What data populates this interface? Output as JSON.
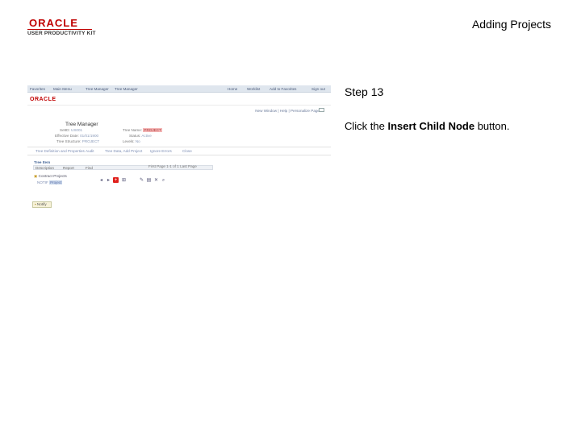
{
  "header": {
    "brand": "ORACLE",
    "product": "USER PRODUCTIVITY KIT",
    "doc_title": "Adding Projects"
  },
  "screenshot": {
    "brand": "ORACLE",
    "top_nav": [
      "Favorites",
      "Main Menu",
      "Tree Manager",
      "Tree Manager"
    ],
    "top_right_nav": [
      "Home",
      "Worklist",
      "Add to Favorites",
      "Sign out"
    ],
    "tool_links": "New Window | Help | Personalize Page",
    "page_title": "Tree Manager",
    "fields": {
      "setid_label": "SetID:",
      "setid_value": "US001",
      "tree_name_label": "Tree Name:",
      "tree_name_value": "PROJECT",
      "effective_date_label": "Effective Date:",
      "effective_date_value": "01/01/1900",
      "status_label": "Status:",
      "status_value": "Active",
      "tree_structure_label": "Tree Structure:",
      "tree_structure_value": "PROJECT",
      "levels_label": "Levels:",
      "levels_value": "No"
    },
    "links_row": [
      "Tree Definition and Properties",
      "Audit",
      "Tree Data, Add Project",
      "Ignore Errors",
      "Close"
    ],
    "section_label": "Tree Item",
    "grid_headers": [
      "Description",
      "Report",
      "Find"
    ],
    "pager": "First Page  1-1 of 1  Last Page",
    "tree_root": "Contract Projects",
    "tree_child": "NOTIF",
    "tree_child_selected": "Project"
  },
  "icons": [
    "arrow-left-icon",
    "arrow-right-icon",
    "insert-child-node-icon",
    "insert-sibling-icon",
    "edit-icon",
    "delete-icon",
    "cut-icon",
    "search-icon"
  ],
  "notify_label": "Notify",
  "step_label": "Step 13",
  "instruction": {
    "prefix": "Click the ",
    "bold": "Insert Child Node",
    "suffix": " button."
  },
  "colors": {
    "oracle_red": "#c00000",
    "highlight_button": "#e0201c"
  }
}
